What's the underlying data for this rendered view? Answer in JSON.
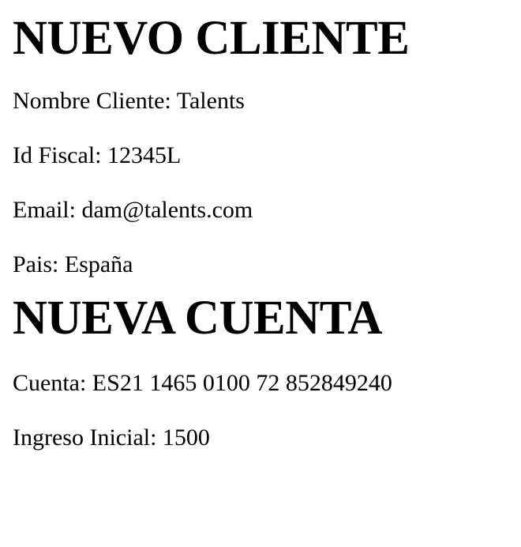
{
  "client_section": {
    "heading": "NUEVO CLIENTE",
    "lines": [
      "Nombre Cliente: Talents",
      "Id Fiscal: 12345L",
      "Email: dam@talents.com",
      "Pais: España"
    ]
  },
  "account_section": {
    "heading": "NUEVA CUENTA",
    "lines": [
      "Cuenta: ES21 1465 0100 72 852849240",
      "Ingreso Inicial: 1500"
    ]
  }
}
